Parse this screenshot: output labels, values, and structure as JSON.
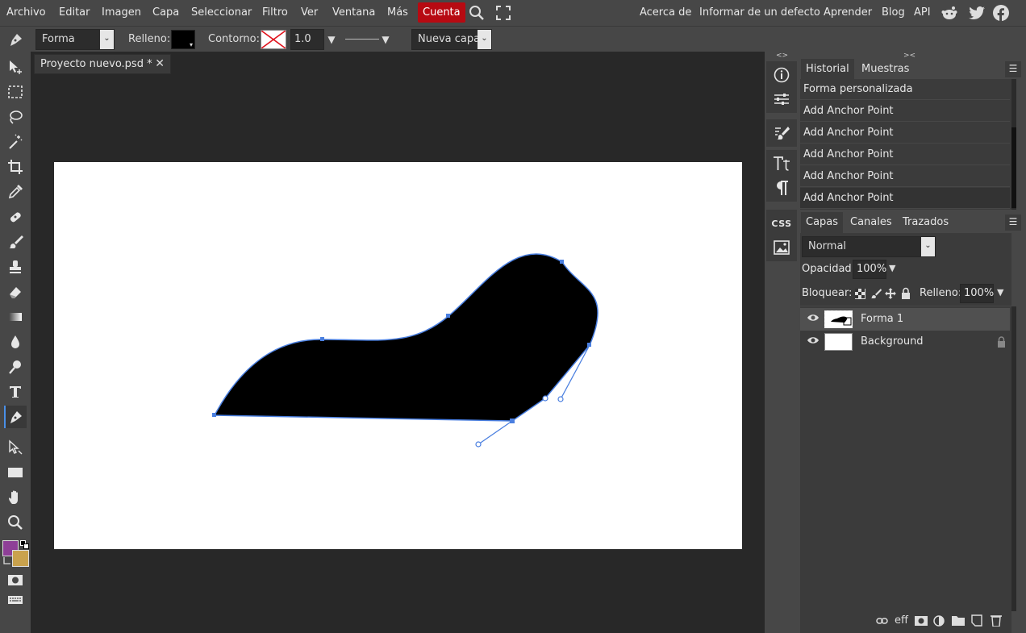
{
  "menu": {
    "items": [
      "Archivo",
      "Editar",
      "Imagen",
      "Capa",
      "Seleccionar",
      "Filtro",
      "Ver",
      "Ventana",
      "Más"
    ],
    "account": "Cuenta",
    "right_links": [
      "Acerca de",
      "Informar de un defecto",
      "Aprender",
      "Blog",
      "API"
    ],
    "accent_color": "#b70a12"
  },
  "options": {
    "shape_mode": "Forma",
    "fill_label": "Relleno:",
    "fill_color": "#000000",
    "stroke_label": "Contorno:",
    "stroke_width": "1.0 px",
    "layer_mode": "Nueva capa"
  },
  "document": {
    "tab_title": "Proyecto nuevo.psd *",
    "canvas_color": "#ffffff",
    "shape_fill": "#000000",
    "path_color": "#4a7fe0"
  },
  "colors": {
    "foreground": "#8e3f97",
    "background": "#c9a24d"
  },
  "history": {
    "tabs": [
      "Historial",
      "Muestras"
    ],
    "items": [
      "Forma personalizada",
      "Add Anchor Point",
      "Add Anchor Point",
      "Add Anchor Point",
      "Add Anchor Point",
      "Add Anchor Point"
    ]
  },
  "layers": {
    "tabs": [
      "Capas",
      "Canales",
      "Trazados"
    ],
    "blend_mode": "Normal",
    "opacity_label": "Opacidad:",
    "opacity_value": "100%",
    "lock_label": "Bloquear:",
    "fill_label": "Relleno:",
    "fill_value": "100%",
    "items": [
      {
        "name": "Forma 1",
        "selected": true
      },
      {
        "name": "Background",
        "selected": false,
        "locked": true
      }
    ],
    "footer_fx": "eff"
  },
  "mini_panel": {
    "css_label": "CSS"
  }
}
